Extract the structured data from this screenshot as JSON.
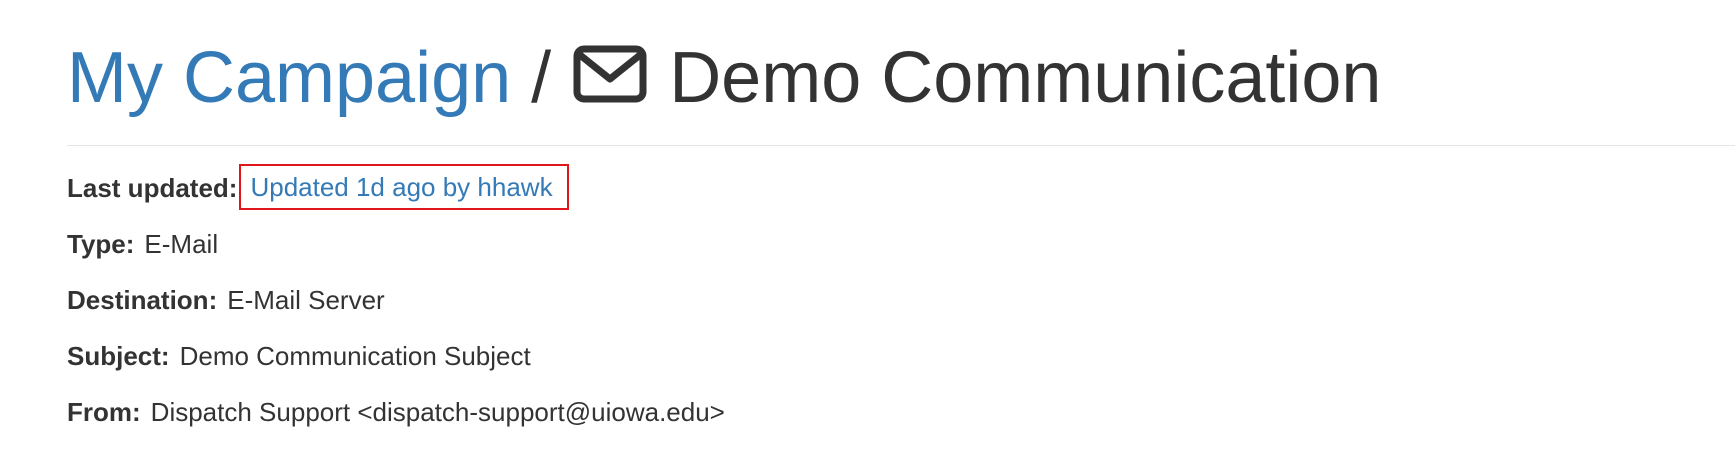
{
  "header": {
    "campaign_link": "My Campaign",
    "separator": "/",
    "icon": "envelope-icon",
    "title": "Demo Communication"
  },
  "details": {
    "last_updated": {
      "label": "Last updated:",
      "value": "Updated 1d ago by hhawk"
    },
    "type": {
      "label": "Type:",
      "value": "E-Mail"
    },
    "destination": {
      "label": "Destination:",
      "value": "E-Mail Server"
    },
    "subject": {
      "label": "Subject:",
      "value": "Demo Communication Subject"
    },
    "from": {
      "label": "From:",
      "value": "Dispatch Support <dispatch-support@uiowa.edu>"
    }
  },
  "colors": {
    "link": "#337ab7",
    "text": "#333333",
    "highlight_border": "#e0161b",
    "divider": "#e5e5e5"
  }
}
